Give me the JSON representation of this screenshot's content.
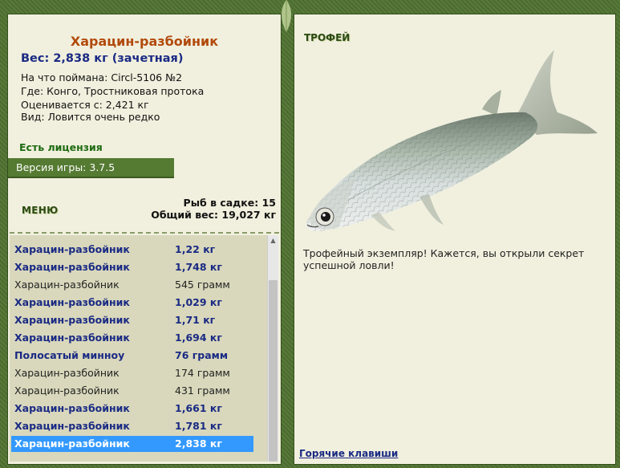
{
  "left": {
    "fish_name": "Харацин-разбойник",
    "weight_line": "Вес: 2,838 кг (зачетная)",
    "info": [
      "На что поймана: Circl-5106 №2",
      "Где: Конго, Тростниковая протока",
      "Оценивается с: 2,421 кг",
      "Вид: Ловится очень редко"
    ],
    "license": "Есть лицензия",
    "version": "Версия игры: 3.7.5",
    "menu_label": "МЕНЮ",
    "stats": {
      "fish_in_net": "Рыб в садке: 15",
      "total_weight": "Общий вес: 19,027 кг"
    },
    "list": [
      {
        "name": "Харацин-разбойник",
        "weight": "1,22 кг",
        "style": "bold"
      },
      {
        "name": "Харацин-разбойник",
        "weight": "1,748 кг",
        "style": "bold"
      },
      {
        "name": "Харацин-разбойник",
        "weight": "545 грамм",
        "style": "plain"
      },
      {
        "name": "Харацин-разбойник",
        "weight": "1,029 кг",
        "style": "bold"
      },
      {
        "name": "Харацин-разбойник",
        "weight": "1,71 кг",
        "style": "bold"
      },
      {
        "name": "Харацин-разбойник",
        "weight": "1,694 кг",
        "style": "bold"
      },
      {
        "name": "Полосатый минноу",
        "weight": "76 грамм",
        "style": "bold"
      },
      {
        "name": "Харацин-разбойник",
        "weight": "174 грамм",
        "style": "plain"
      },
      {
        "name": "Харацин-разбойник",
        "weight": "431 грамм",
        "style": "plain"
      },
      {
        "name": "Харацин-разбойник",
        "weight": "1,661 кг",
        "style": "bold"
      },
      {
        "name": "Харацин-разбойник",
        "weight": "1,781 кг",
        "style": "bold"
      },
      {
        "name": "Харацин-разбойник",
        "weight": "2,838 кг",
        "style": "sel"
      }
    ]
  },
  "right": {
    "trophy_label": "ТРОФЕЙ",
    "description": "Трофейный экземпляр! Кажется, вы открыли секрет успешной ловли!",
    "hotkeys": "Горячие клавиши"
  },
  "colors": {
    "frame": "#4f7230",
    "panel": "#f1f0de",
    "title": "#b24a0c",
    "accent_blue": "#1a2a84",
    "selection": "#3399ff"
  }
}
